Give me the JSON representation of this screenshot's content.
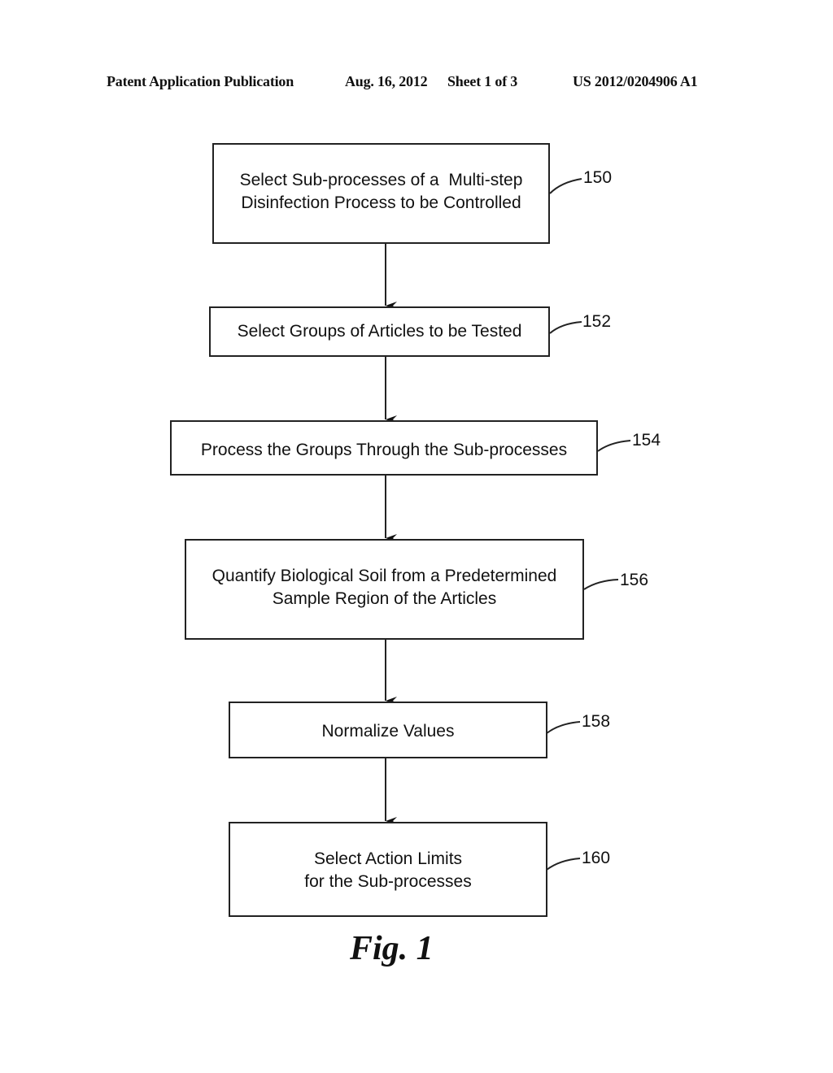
{
  "header": {
    "publication_type": "Patent Application Publication",
    "date": "Aug. 16, 2012",
    "sheet": "Sheet 1 of 3",
    "patent_number": "US 2012/0204906 A1"
  },
  "flowchart": {
    "steps": [
      {
        "ref": "150",
        "text": "Select Sub-processes of a  Multi-step\nDisinfection Process to be Controlled"
      },
      {
        "ref": "152",
        "text": "Select Groups of Articles to be Tested"
      },
      {
        "ref": "154",
        "text": "Process the Groups Through the Sub-processes"
      },
      {
        "ref": "156",
        "text": "Quantify Biological Soil from a Predetermined\nSample Region of the Articles"
      },
      {
        "ref": "158",
        "text": "Normalize Values"
      },
      {
        "ref": "160",
        "text": "Select Action Limits\nfor the Sub-processes"
      }
    ],
    "edges": [
      {
        "from": "150",
        "to": "152"
      },
      {
        "from": "152",
        "to": "154"
      },
      {
        "from": "154",
        "to": "156"
      },
      {
        "from": "156",
        "to": "158"
      },
      {
        "from": "158",
        "to": "160"
      }
    ]
  },
  "figure_label": "Fig. 1"
}
